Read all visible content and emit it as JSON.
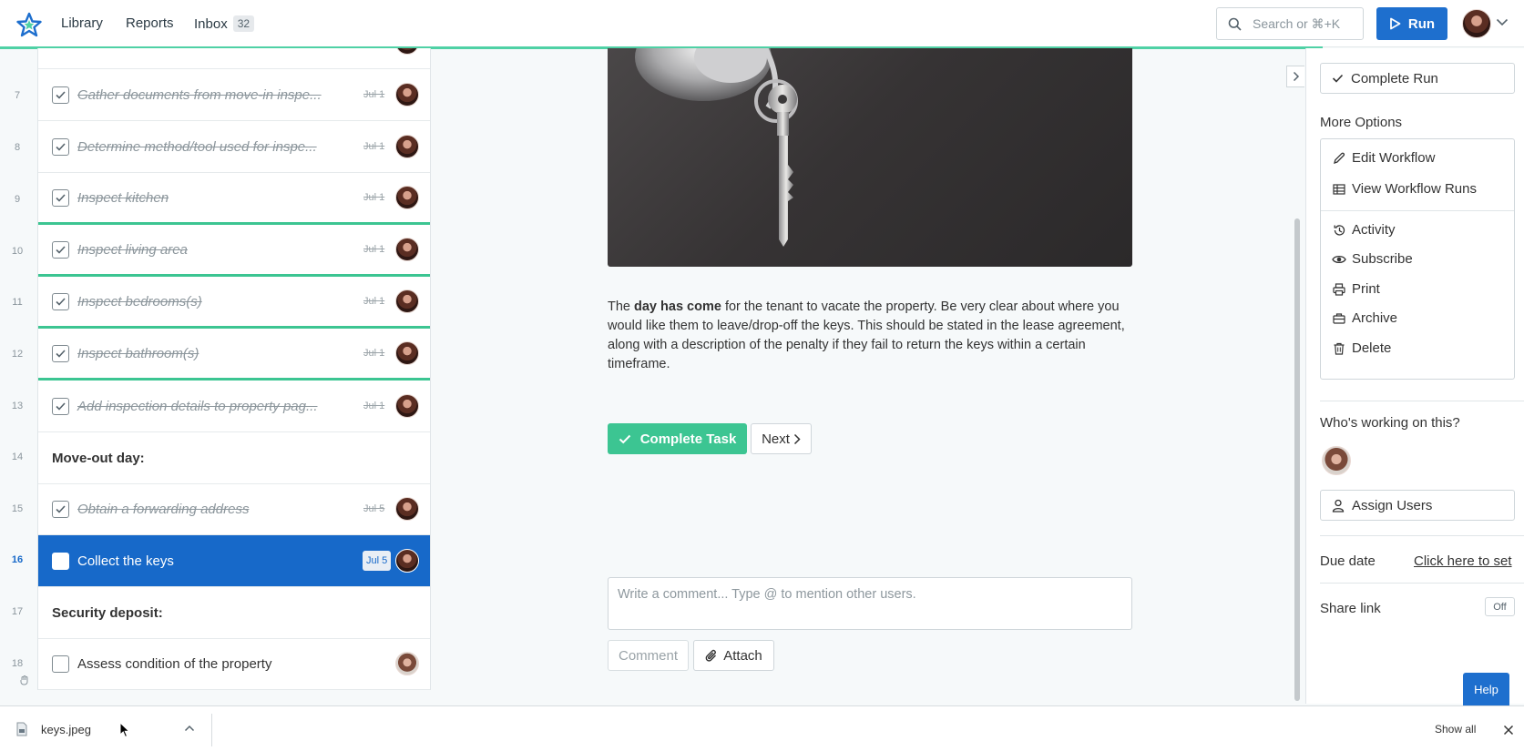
{
  "header": {
    "nav": [
      {
        "label": "Library"
      },
      {
        "label": "Reports"
      },
      {
        "label": "Inbox",
        "badge": "32"
      }
    ],
    "search_placeholder": "Search or ⌘+K",
    "run_label": "Run"
  },
  "tasks": [
    {
      "num": "7",
      "label": "Gather documents from move-in inspe...",
      "due": "Jul 1",
      "done": true
    },
    {
      "num": "8",
      "label": "Determine method/tool used for inspe...",
      "due": "Jul 1",
      "done": true
    },
    {
      "num": "9",
      "label": "Inspect kitchen",
      "due": "Jul 1",
      "done": true
    },
    {
      "num": "10",
      "label": "Inspect living area",
      "due": "Jul 1",
      "done": true
    },
    {
      "num": "11",
      "label": "Inspect bedrooms(s)",
      "due": "Jul 1",
      "done": true
    },
    {
      "num": "12",
      "label": "Inspect bathroom(s)",
      "due": "Jul 1",
      "done": true
    },
    {
      "num": "13",
      "label": "Add inspection details to property pag...",
      "due": "Jul 1",
      "done": true
    },
    {
      "num": "14",
      "label": "Move-out day:",
      "heading": true
    },
    {
      "num": "15",
      "label": "Obtain a forwarding address",
      "due": "Jul 5",
      "done": true
    },
    {
      "num": "16",
      "label": "Collect the keys",
      "due": "Jul 5",
      "active": true
    },
    {
      "num": "17",
      "label": "Security deposit:",
      "heading": true
    },
    {
      "num": "18",
      "label": "Assess condition of the property"
    }
  ],
  "main": {
    "description": {
      "pre": "The ",
      "bold": "day has come",
      "post": " for the tenant to vacate the property. Be very clear about where you would like them to leave/drop-off the keys. This should be stated in the lease agreement, along with a description of the penalty if they fail to return the keys within a certain timeframe."
    },
    "complete_task_label": "Complete Task",
    "next_label": "Next",
    "comment_placeholder": "Write a comment... Type @ to mention other users.",
    "comment_label": "Comment",
    "attach_label": "Attach"
  },
  "sidebar": {
    "complete_run_label": "Complete Run",
    "more_options_heading": "More Options",
    "options": [
      {
        "label": "Edit Workflow",
        "icon": "pencil-icon"
      },
      {
        "label": "View Workflow Runs",
        "icon": "table-icon"
      },
      {
        "label": "Activity",
        "icon": "history-icon"
      },
      {
        "label": "Subscribe",
        "icon": "eye-icon"
      },
      {
        "label": "Print",
        "icon": "printer-icon"
      },
      {
        "label": "Archive",
        "icon": "archive-icon"
      },
      {
        "label": "Delete",
        "icon": "trash-icon"
      }
    ],
    "working_heading": "Who's working on this?",
    "assign_label": "Assign Users",
    "due_label": "Due date",
    "due_link": "Click here to set",
    "share_label": "Share link",
    "share_toggle": "Off",
    "help_label": "Help"
  },
  "downloads": {
    "file_name": "keys.jpeg",
    "show_all": "Show all"
  },
  "colors": {
    "brand_blue": "#1e6fce",
    "success_green": "#3cc592",
    "progress_green": "#4fd1a5"
  }
}
